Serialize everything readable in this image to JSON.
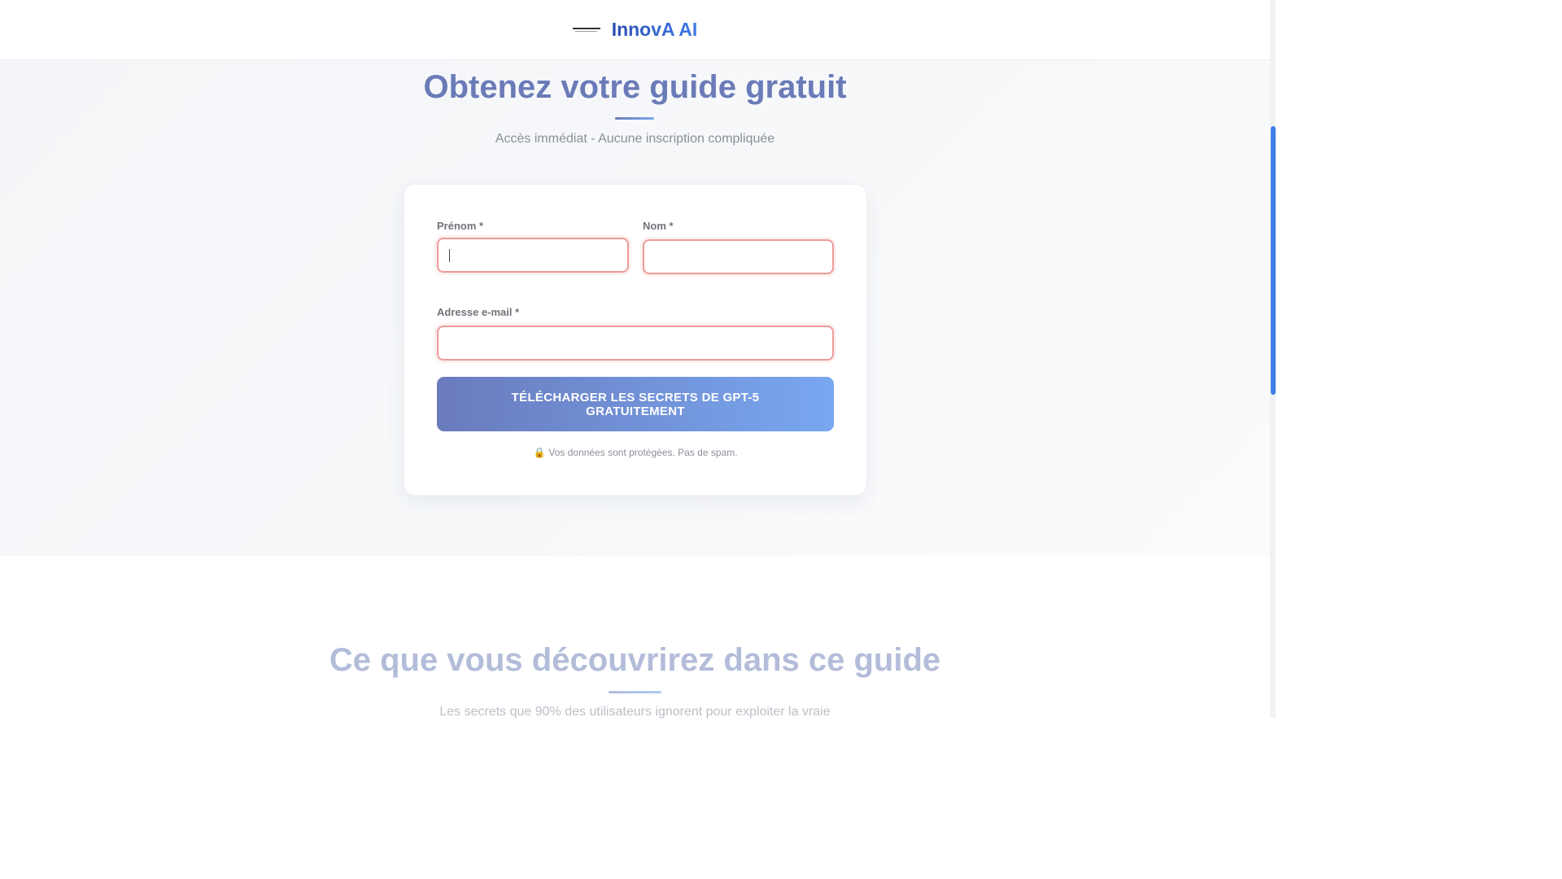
{
  "header": {
    "brand": "InnovA AI",
    "logo_icon": "innova-ai-logo"
  },
  "hero": {
    "title": "Obtenez votre guide gratuit",
    "subtitle": "Accès immédiat - Aucune inscription compliquée"
  },
  "form": {
    "first_name": {
      "label": "Prénom *",
      "value": ""
    },
    "last_name": {
      "label": "Nom *",
      "value": ""
    },
    "email": {
      "label": "Adresse e-mail *",
      "value": ""
    },
    "submit_label": "TÉLÉCHARGER LES SECRETS DE GPT-5 GRATUITEMENT",
    "privacy_icon": "🔒",
    "privacy_text": "Vos données sont protégées. Pas de spam."
  },
  "section2": {
    "title": "Ce que vous découvrirez dans ce guide",
    "subtitle": "Les secrets que 90% des utilisateurs ignorent pour exploiter la vraie"
  },
  "colors": {
    "brand_start": "#2a4cb0",
    "brand_end": "#3e7be8",
    "button_start": "#6a7bbd",
    "button_end": "#78a7f0",
    "input_error_border": "#ee9a9a",
    "scrollbar_thumb": "#3f7fe6"
  }
}
